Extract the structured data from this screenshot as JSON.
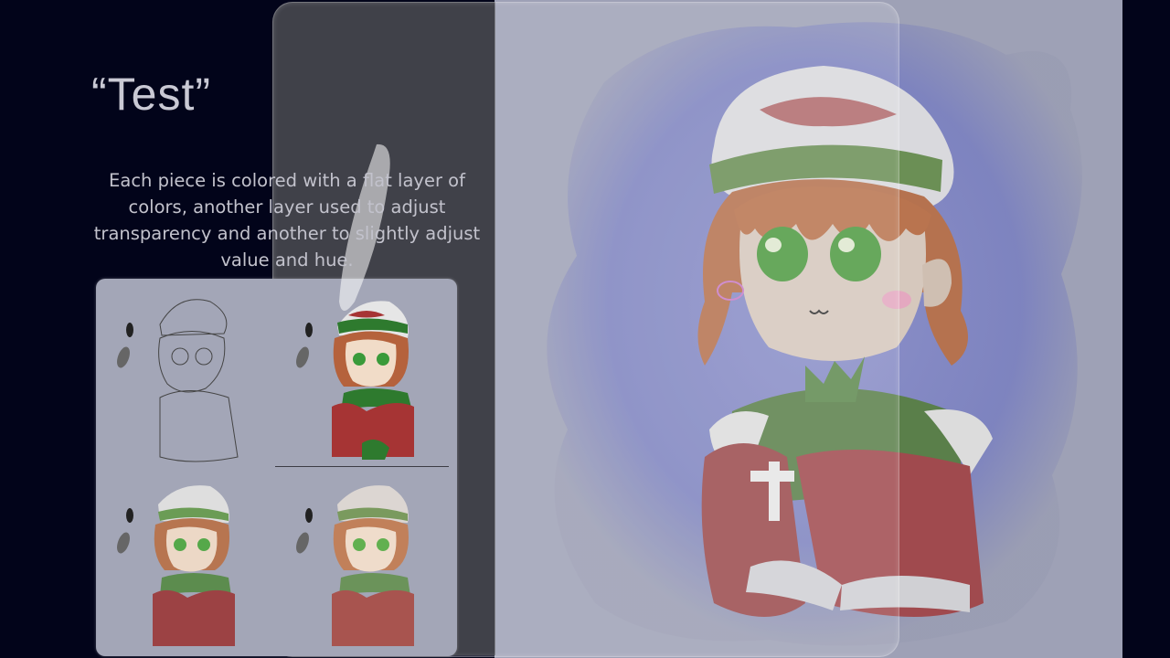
{
  "slide": {
    "title": "“Test”",
    "description": "Each piece is colored with a flat layer of colors, another layer used to adjust transparency and another to slightly adjust value and hue."
  },
  "process_steps": [
    "lineart",
    "flat-colors",
    "transparency-adjust",
    "value-hue-adjust"
  ],
  "colors": {
    "background": "#02041a",
    "text": "#c9c9d4",
    "watercolor": "#7f84c4",
    "hat": "#e6e6e6",
    "hat_band": "#6e9a58",
    "hair": "#c27a55",
    "eyes": "#62b050",
    "dress_red": "#a04a4e",
    "dress_green": "#5e8a52"
  }
}
